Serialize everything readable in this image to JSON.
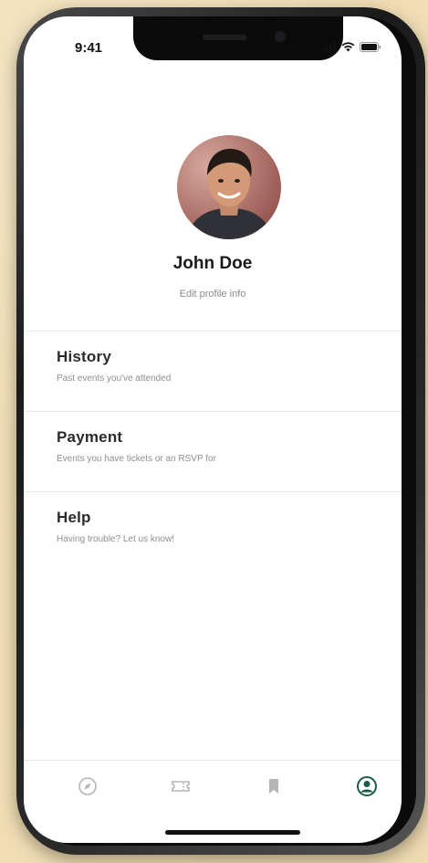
{
  "status_bar": {
    "time": "9:41",
    "icons": [
      "signal-icon",
      "wifi-icon",
      "battery-icon"
    ]
  },
  "profile": {
    "name": "John Doe",
    "edit_label": "Edit profile info"
  },
  "menu": {
    "items": [
      {
        "title": "History",
        "subtitle": "Past events you've attended"
      },
      {
        "title": "Payment",
        "subtitle": "Events you have tickets or an RSVP for"
      },
      {
        "title": "Help",
        "subtitle": "Having trouble? Let us know!"
      }
    ]
  },
  "tab_bar": {
    "tabs": [
      {
        "icon": "explore-icon",
        "active": false
      },
      {
        "icon": "ticket-icon",
        "active": false
      },
      {
        "icon": "bookmark-icon",
        "active": false
      },
      {
        "icon": "profile-icon",
        "active": true
      }
    ],
    "active_color": "#1f5a45",
    "inactive_color": "#b5b5b5"
  },
  "colors": {
    "background": "#f0ddb4",
    "screen": "#ffffff",
    "divider": "#e8e8e8"
  }
}
